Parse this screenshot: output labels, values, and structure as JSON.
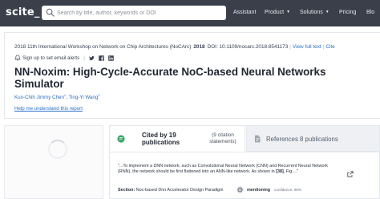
{
  "header": {
    "logo": "scite_",
    "search_placeholder": "Search by title, author, keywords or DOI",
    "nav": [
      {
        "label": "Assistant",
        "has_menu": false
      },
      {
        "label": "Product",
        "has_menu": true
      },
      {
        "label": "Solutions",
        "has_menu": true
      },
      {
        "label": "Pricing",
        "has_menu": false
      },
      {
        "label": "Blo",
        "has_menu": false
      }
    ]
  },
  "paper": {
    "venue": "2018 11th International Workshop on Network on Chip Architectures (NoCArc)",
    "year": "2018",
    "doi": "DOI: 10.1109/nocarc.2018.8541173",
    "view_full_text": "View full text",
    "cite": "Cite",
    "alerts_label": "Sign up to set email alerts",
    "title": "NN-Noxim: High-Cycle-Accurate NoC-based Neural Networks Simulator",
    "authors": [
      {
        "name": "Kun-Chih Jimmy Chen",
        "sup": "1"
      },
      {
        "name": "Ting-Yi Wang",
        "sup": "2"
      }
    ],
    "help_link": "Help me understand this report"
  },
  "tabs": {
    "cited_label": "Cited by 19 publications",
    "cited_count": "(9 citation statements)",
    "references_label": "References 8 publications"
  },
  "citation": {
    "quote_before": "\"...To implement a DNN network, such as Convolutional Neural Network (CNN) and Recurrent Neural Network (RNN), the network should be first flattened into an ANN-like network. As shown in",
    "quote_ref": "[38]",
    "quote_after": ", Fig....\"",
    "section_label": "Section:",
    "section_value": "Noc-based Dnn Accelerator Design Paradigm",
    "mention_label": "mentioning",
    "confidence": "confidence: 90%"
  },
  "colors": {
    "topbar": "#3a3f4a",
    "link": "#2a6fcb",
    "mentioning_green": "#3aa66a"
  }
}
